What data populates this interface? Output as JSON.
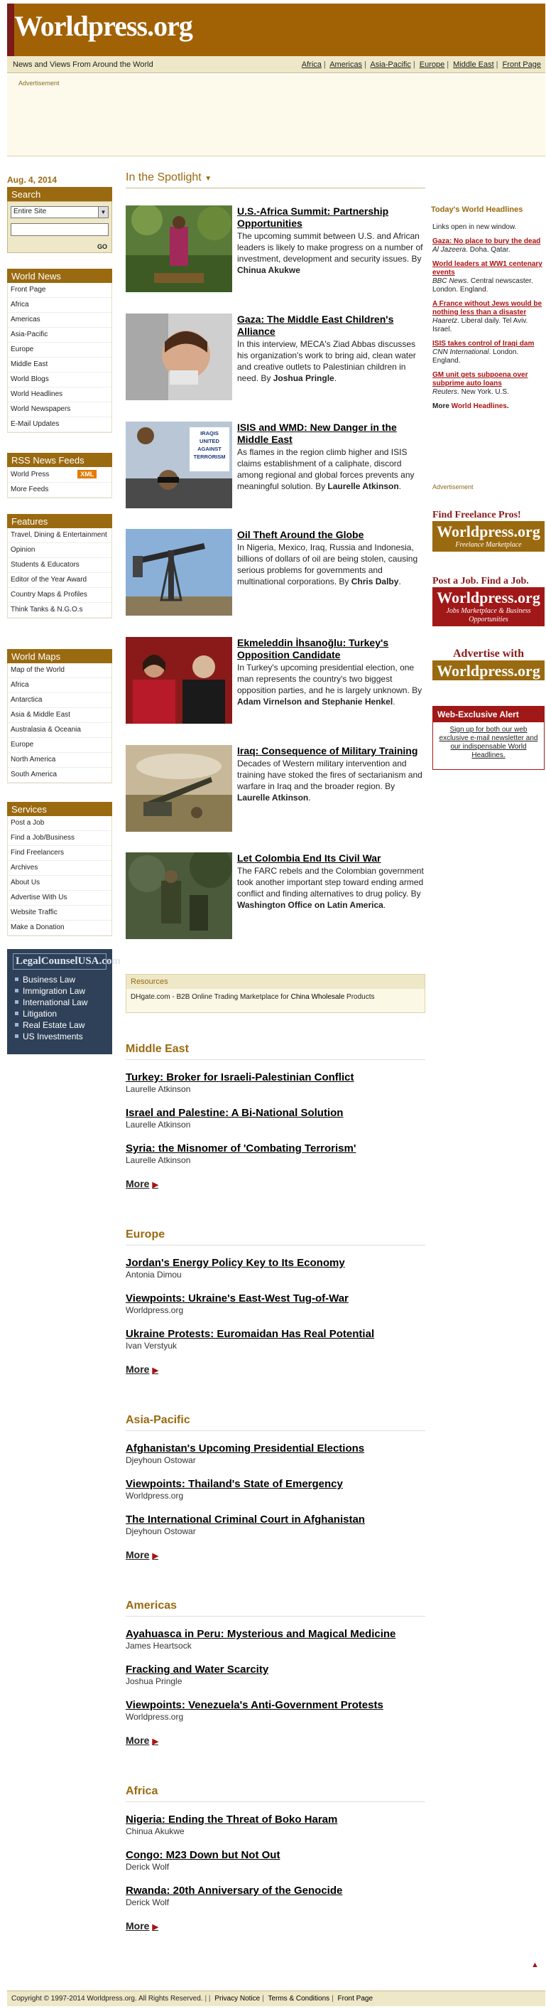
{
  "header": {
    "logo": "Worldpress.org",
    "tagline": "News and Views From Around the World",
    "nav": [
      "Africa",
      "Americas",
      "Asia-Pacific",
      "Europe",
      "Middle East",
      "Front Page"
    ]
  },
  "ad_label": "Advertisement",
  "date": "Aug. 4, 2014",
  "search": {
    "title": "Search",
    "scope": "Entire Site",
    "go_label": "GO"
  },
  "sidebar": {
    "world_news": {
      "title": "World News",
      "items": [
        "Front Page",
        "Africa",
        "Americas",
        "Asia-Pacific",
        "Europe",
        "Middle East",
        "World Blogs",
        "World Headlines",
        "World Newspapers",
        "E-Mail Updates"
      ]
    },
    "rss": {
      "title": "RSS News Feeds",
      "items": [
        "World Press",
        "More Feeds"
      ],
      "xml": "XML"
    },
    "features": {
      "title": "Features",
      "items": [
        "Travel, Dining & Entertainment",
        "Opinion",
        "Students & Educators",
        "Editor of the Year Award",
        "Country Maps & Profiles",
        "Think Tanks & N.G.O.s"
      ]
    },
    "world_maps": {
      "title": "World Maps",
      "items": [
        "Map of the World",
        "Africa",
        "Antarctica",
        "Asia & Middle East",
        "Australasia & Oceania",
        "Europe",
        "North America",
        "South America"
      ]
    },
    "services": {
      "title": "Services",
      "items": [
        "Post a Job",
        "Find a Job/Business",
        "Find Freelancers",
        "Archives",
        "About Us",
        "Advertise With Us",
        "Website Traffic",
        "Make a Donation"
      ]
    },
    "legal": {
      "title": "LegalCounselUSA.com",
      "items": [
        "Business Law",
        "Immigration Law",
        "International Law",
        "Litigation",
        "Real Estate Law",
        "US Investments"
      ]
    }
  },
  "spotlight": {
    "title": "In the Spotlight",
    "stories": [
      {
        "title": "U.S.-Africa Summit: Partnership Opportunities",
        "desc": "The upcoming summit between U.S. and African leaders is likely to make progress on a number of investment, development and security issues. By ",
        "author": "Chinua Akukwe",
        "end": ""
      },
      {
        "title": "Gaza: The Middle East Children's Alliance",
        "desc": "In this interview, MECA's Ziad Abbas discusses his organization's work to bring aid, clean water and creative outlets to Palestinian children in need. By ",
        "author": "Joshua Pringle",
        "end": "."
      },
      {
        "title": "ISIS and WMD: New Danger in the Middle East",
        "desc": "As flames in the region climb higher and ISIS claims establishment of a caliphate, discord among regional and global forces prevents any meaningful solution. By ",
        "author": "Laurelle Atkinson",
        "end": "."
      },
      {
        "title": "Oil Theft Around the Globe",
        "desc": "In Nigeria, Mexico, Iraq, Russia and Indonesia, billions of dollars of oil are being stolen, causing serious problems for governments and multinational corporations. By ",
        "author": "Chris Dalby",
        "end": "."
      },
      {
        "title": "Ekmeleddin İhsanoğlu: Turkey's Opposition Candidate",
        "desc": "In Turkey's upcoming presidential election, one man represents the country's two biggest opposition parties, and he is largely unknown. By ",
        "author": "Adam Virnelson and Stephanie Henkel",
        "end": "."
      },
      {
        "title": "Iraq: Consequence of Military Training",
        "desc": "Decades of Western military intervention and training have stoked the fires of sectarianism and warfare in Iraq and the broader region. By ",
        "author": "Laurelle Atkinson",
        "end": "."
      },
      {
        "title": "Let Colombia End Its Civil War",
        "desc": "The FARC rebels and the Colombian government took another important step toward ending armed conflict and finding alternatives to drug policy. By ",
        "author": "Washington Office on Latin America",
        "end": "."
      }
    ],
    "isis_sign": "IRAQIS UNITED AGAINST TERRORISM"
  },
  "resources": {
    "title": "Resources",
    "text": "DHgate.com - B2B Online Trading Marketplace for ",
    "link": "China Wholesale",
    "end": " Products"
  },
  "sections": [
    {
      "title": "Middle East",
      "items": [
        {
          "title": "Turkey: Broker for Israeli-Palestinian Conflict",
          "author": "Laurelle Atkinson"
        },
        {
          "title": "Israel and Palestine: A Bi-National Solution",
          "author": "Laurelle Atkinson"
        },
        {
          "title": "Syria: the Misnomer of 'Combating Terrorism'",
          "author": "Laurelle Atkinson"
        }
      ]
    },
    {
      "title": "Europe",
      "items": [
        {
          "title": "Jordan's Energy Policy Key to Its Economy",
          "author": "Antonia Dimou"
        },
        {
          "title": "Viewpoints: Ukraine's East-West Tug-of-War",
          "author": "Worldpress.org"
        },
        {
          "title": "Ukraine Protests: Euromaidan Has Real Potential",
          "author": "Ivan Verstyuk"
        }
      ]
    },
    {
      "title": "Asia-Pacific",
      "items": [
        {
          "title": "Afghanistan's Upcoming Presidential Elections",
          "author": "Djeyhoun Ostowar"
        },
        {
          "title": "Viewpoints: Thailand's State of Emergency",
          "author": "Worldpress.org"
        },
        {
          "title": "The International Criminal Court in Afghanistan",
          "author": "Djeyhoun Ostowar"
        }
      ]
    },
    {
      "title": "Americas",
      "items": [
        {
          "title": "Ayahuasca in Peru: Mysterious and Magical Medicine",
          "author": "James Heartsock"
        },
        {
          "title": "Fracking and Water Scarcity",
          "author": "Joshua Pringle"
        },
        {
          "title": "Viewpoints: Venezuela's Anti-Government Protests",
          "author": "Worldpress.org"
        }
      ]
    },
    {
      "title": "Africa",
      "items": [
        {
          "title": "Nigeria: Ending the Threat of Boko Haram",
          "author": "Chinua Akukwe"
        },
        {
          "title": "Congo: M23 Down but Not Out",
          "author": "Derick Wolf"
        },
        {
          "title": "Rwanda: 20th Anniversary of the Genocide",
          "author": "Derick Wolf"
        }
      ]
    }
  ],
  "more_label": "More",
  "headlines": {
    "title": "Today's World Headlines",
    "note": "Links open in new window.",
    "items": [
      {
        "h": "Gaza: No place to bury the dead",
        "src": "Al Jazeera",
        "loc": ". Doha. Qatar."
      },
      {
        "h": "World leaders at WW1 centenary events",
        "src": "BBC News",
        "loc": ". Central newscaster. London. England."
      },
      {
        "h": "A France without Jews would be nothing less than a disaster",
        "src": "Haaretz",
        "loc": ". Liberal daily. Tel Aviv. Israel."
      },
      {
        "h": "ISIS takes control of Iraqi dam",
        "src": "CNN International",
        "loc": ". London. England."
      },
      {
        "h": "GM unit gets subpoena over subprime auto loans",
        "src": "Reuters",
        "loc": ". New York. U.S."
      }
    ],
    "more_prefix": "More ",
    "more_link": "World Headlines",
    "more_end": "."
  },
  "right_ad_label": "Advertisement",
  "promos": [
    {
      "tag": "Find Freelance Pros!",
      "logo": "Worldpress.org",
      "sub": "Freelance Marketplace"
    },
    {
      "tag": "Post a Job. Find a Job.",
      "logo": "Worldpress.org",
      "sub": "Jobs Marketplace & Business Opportunities"
    },
    {
      "tag": "Advertise with",
      "logo": "Worldpress.org",
      "sub": ""
    }
  ],
  "alert": {
    "title": "Web-Exclusive Alert",
    "body": "Sign up for both our web exclusive e-mail newsletter and our indispensable World Headlines."
  },
  "footer": {
    "copy": "Copyright © 1997-2014 Worldpress.org. All Rights Reserved.",
    "links": [
      "Privacy Notice",
      "Terms & Conditions",
      "Front Page"
    ]
  },
  "colors": {
    "brand": "#9a6a10",
    "accent_red": "#a11818",
    "header_bg": "#a16206"
  }
}
